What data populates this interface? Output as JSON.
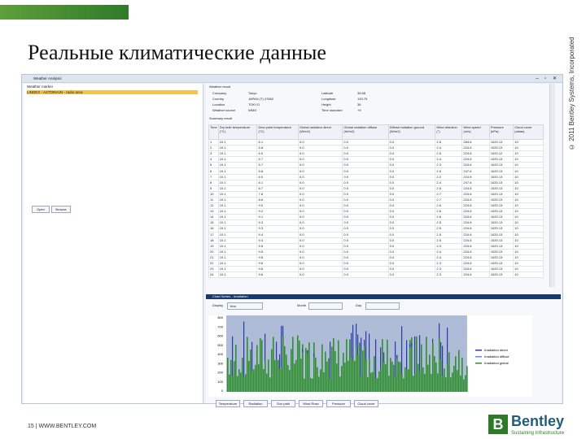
{
  "slide": {
    "title": "Реальные климатические данные",
    "copyright": "© 2011 Bentley Systems, Incorporated",
    "footer": "15 | WWW.BENTLEY.COM",
    "logo_name": "Bentley",
    "logo_tagline": "Sustaining Infrastructure"
  },
  "app": {
    "window_title": "Weather Analysis",
    "left": {
      "tree_header": "Weather marker",
      "selected_item": "LINDEX - ASTORIA/N - radio area",
      "buttons": [
        "Open",
        "Browse"
      ]
    },
    "info": {
      "header": "Weather result",
      "fields": [
        {
          "label": "Company",
          "value": "Tokyo"
        },
        {
          "label": "Country",
          "value": "JAPAN (T) 47662"
        },
        {
          "label": "Location",
          "value": "TOKYO"
        },
        {
          "label": "Weather source",
          "value": "WMO"
        },
        {
          "label": "Latitude",
          "value": "35.68"
        },
        {
          "label": "Longitude",
          "value": "139.75"
        },
        {
          "label": "Height",
          "value": "36"
        },
        {
          "label": "Time standard",
          "value": "+9"
        }
      ],
      "subheader": "Summary result"
    },
    "table": {
      "columns": [
        "Time",
        "Dry bulb temperature (°C)",
        "Dew point temperature (°C)",
        "Global radiation direct (W/m2)",
        "Global radiation diffuse (W/m2)",
        "Diffuse radiation ground (W/m2)",
        "Wind direction (°)",
        "Wind speed (m/s)",
        "Pressure (hPa)",
        "Cloud cover (oktas)"
      ],
      "rows": [
        [
          "1",
          "10.1",
          "6.1",
          "0.0",
          "0.0",
          "0.0",
          "2.6",
          "284.6",
          "1020.13",
          "10"
        ],
        [
          "2",
          "10.1",
          "5.8",
          "0.0",
          "0.0",
          "0.0",
          "2.4",
          "224.6",
          "1020.13",
          "10"
        ],
        [
          "3",
          "10.1",
          "6.0",
          "0.0",
          "0.0",
          "0.0",
          "2.5",
          "224.6",
          "1020.12",
          "10"
        ],
        [
          "4",
          "10.1",
          "5.7",
          "0.0",
          "0.0",
          "0.0",
          "2.4",
          "224.6",
          "1020.13",
          "10"
        ],
        [
          "5",
          "10.1",
          "5.7",
          "0.0",
          "0.0",
          "0.0",
          "2.3",
          "224.6",
          "1020.13",
          "10"
        ],
        [
          "6",
          "10.1",
          "5.8",
          "0.0",
          "0.0",
          "0.0",
          "2.5",
          "247.6",
          "1020.13",
          "10"
        ],
        [
          "7",
          "10.1",
          "6.0",
          "0.0",
          "0.0",
          "0.0",
          "2.2",
          "224.6",
          "1020.13",
          "10"
        ],
        [
          "8",
          "10.1",
          "6.1",
          "0.0",
          "0.0",
          "0.0",
          "2.4",
          "247.6",
          "1020.13",
          "10"
        ],
        [
          "9",
          "10.1",
          "6.7",
          "0.0",
          "0.0",
          "0.0",
          "2.6",
          "224.6",
          "1020.13",
          "10"
        ],
        [
          "10",
          "10.1",
          "7.8",
          "0.0",
          "0.0",
          "0.0",
          "2.7",
          "224.6",
          "1020.13",
          "10"
        ],
        [
          "11",
          "10.1",
          "8.6",
          "0.0",
          "0.0",
          "0.0",
          "2.7",
          "224.6",
          "1020.13",
          "10"
        ],
        [
          "12",
          "10.1",
          "9.0",
          "0.0",
          "0.0",
          "0.0",
          "2.6",
          "224.6",
          "1020.13",
          "10"
        ],
        [
          "13",
          "10.1",
          "9.2",
          "0.0",
          "0.0",
          "0.0",
          "2.6",
          "224.6",
          "1020.13",
          "10"
        ],
        [
          "14",
          "10.1",
          "9.1",
          "0.0",
          "0.0",
          "0.0",
          "2.6",
          "224.6",
          "1020.13",
          "10"
        ],
        [
          "15",
          "10.1",
          "9.3",
          "0.0",
          "0.0",
          "0.0",
          "2.5",
          "224.6",
          "1020.13",
          "10"
        ],
        [
          "16",
          "10.1",
          "9.3",
          "0.0",
          "0.0",
          "0.0",
          "2.5",
          "224.6",
          "1020.13",
          "10"
        ],
        [
          "17",
          "10.1",
          "9.4",
          "0.0",
          "0.0",
          "0.0",
          "2.5",
          "224.6",
          "1020.13",
          "10"
        ],
        [
          "18",
          "10.1",
          "9.4",
          "0.0",
          "0.0",
          "0.0",
          "2.5",
          "224.6",
          "1020.13",
          "10"
        ],
        [
          "19",
          "10.1",
          "9.5",
          "0.0",
          "0.0",
          "0.0",
          "2.4",
          "224.6",
          "1020.13",
          "10"
        ],
        [
          "20",
          "10.1",
          "9.5",
          "0.0",
          "0.0",
          "0.0",
          "2.4",
          "224.6",
          "1020.13",
          "10"
        ],
        [
          "21",
          "10.1",
          "9.5",
          "0.0",
          "0.0",
          "0.0",
          "2.4",
          "224.6",
          "1020.13",
          "10"
        ],
        [
          "22",
          "10.1",
          "9.6",
          "0.0",
          "0.0",
          "0.0",
          "2.3",
          "224.6",
          "1020.13",
          "10"
        ],
        [
          "23",
          "10.1",
          "9.6",
          "0.0",
          "0.0",
          "0.0",
          "2.3",
          "224.6",
          "1020.13",
          "10"
        ],
        [
          "24",
          "10.1",
          "9.6",
          "0.0",
          "0.0",
          "0.0",
          "2.3",
          "224.6",
          "1020.13",
          "10"
        ]
      ]
    },
    "chart_panel": {
      "bar_label": "Chart Series - Irradiation",
      "display_label": "Display",
      "display_value": "Year",
      "month_label": "Month",
      "day_label": "Day"
    },
    "bottom_tabs": [
      "Temperature",
      "Radiation",
      "Sun path",
      "Wind Rose",
      "Pressure",
      "Cloud cover"
    ]
  },
  "chart_data": {
    "type": "area",
    "y_ticks": [
      "800",
      "700",
      "600",
      "500",
      "400",
      "300",
      "200",
      "100",
      "0"
    ],
    "ylim": [
      0,
      800
    ],
    "legend_position": "right",
    "series": [
      {
        "name": "Irradiation direct",
        "color": "#2b3aa8"
      },
      {
        "name": "Irradiation diffuse",
        "color": "#6c8cd5"
      },
      {
        "name": "Irradiation global",
        "color": "#2f8f2f"
      }
    ]
  }
}
